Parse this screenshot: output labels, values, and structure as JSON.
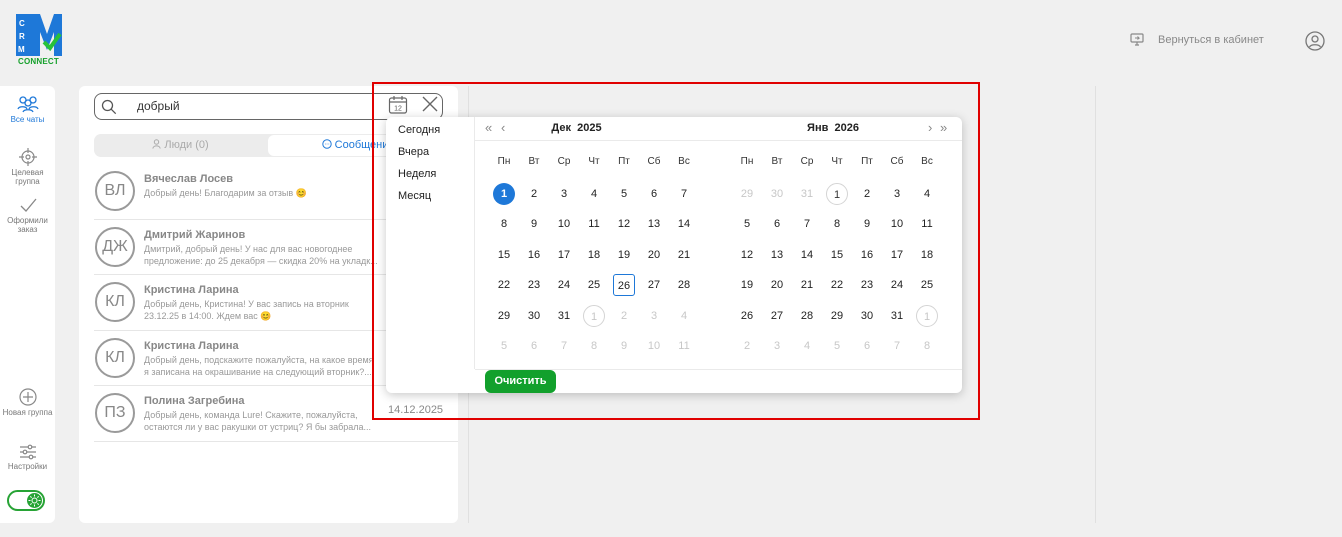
{
  "app": {
    "logo_text": "CONNECT",
    "brand_colors": {
      "blue": "#1e78d8",
      "green": "#15a02b"
    }
  },
  "topbar": {
    "back_label": "Вернуться в кабинет"
  },
  "nav": {
    "items": [
      {
        "label": "Все чаты",
        "icon": "users-icon",
        "active": true
      },
      {
        "label": "Целевая группа",
        "icon": "target-icon"
      },
      {
        "label": "Оформили заказ",
        "icon": "check-icon"
      },
      {
        "label": "Новая группа",
        "icon": "plus-circle-icon"
      },
      {
        "label": "Настройки",
        "icon": "sliders-icon"
      }
    ]
  },
  "search": {
    "value": "добрый"
  },
  "tabs": {
    "people": "Люди (0)",
    "messages": "Сообщения"
  },
  "chats": [
    {
      "initials": "ВЛ",
      "name": "Вячеслав Лосев",
      "preview": "Добрый день! Благодарим за отзыв 😊",
      "date": ""
    },
    {
      "initials": "ДЖ",
      "name": "Дмитрий Жаринов",
      "preview": "Дмитрий, добрый день! У нас для вас новогоднее предложение: до 25 декабря — скидка 20% на укладк...",
      "date": ""
    },
    {
      "initials": "КЛ",
      "name": "Кристина Ларина",
      "preview": "Добрый день, Кристина! У вас запись на вторник 23.12.25 в 14:00. Ждем вас 😊",
      "date": ""
    },
    {
      "initials": "КЛ",
      "name": "Кристина Ларина",
      "preview": "Добрый день, подскажите пожалуйста, на какое время я записана на окрашивание на следующий вторник?...",
      "date": ""
    },
    {
      "initials": "ПЗ",
      "name": "Полина Загребина",
      "preview": "Добрый день, команда Lure! Скажите, пожалуйста, остаются ли у вас ракушки от устриц? Я бы забрала...",
      "date": "14.12.2025"
    }
  ],
  "picker": {
    "presets": [
      "Сегодня",
      "Вчера",
      "Неделя",
      "Месяц"
    ],
    "weekdays": [
      "Пн",
      "Вт",
      "Ср",
      "Чт",
      "Пт",
      "Сб",
      "Вс"
    ],
    "months": [
      {
        "month": "Дек",
        "year": "2025",
        "weeks": [
          [
            [
              1,
              "",
              1
            ],
            [
              2,
              "",
              0
            ],
            [
              3,
              "",
              0
            ],
            [
              4,
              "",
              0
            ],
            [
              5,
              "",
              0
            ],
            [
              6,
              "",
              0
            ],
            [
              7,
              "",
              0
            ]
          ],
          [
            [
              8,
              "",
              0
            ],
            [
              9,
              "",
              0
            ],
            [
              10,
              "",
              0
            ],
            [
              11,
              "",
              0
            ],
            [
              12,
              "",
              0
            ],
            [
              13,
              "",
              0
            ],
            [
              14,
              "",
              0
            ]
          ],
          [
            [
              15,
              "",
              0
            ],
            [
              16,
              "",
              0
            ],
            [
              17,
              "",
              0
            ],
            [
              18,
              "",
              0
            ],
            [
              19,
              "",
              0
            ],
            [
              20,
              "",
              0
            ],
            [
              21,
              "",
              0
            ]
          ],
          [
            [
              22,
              "",
              0
            ],
            [
              23,
              "",
              0
            ],
            [
              24,
              "",
              0
            ],
            [
              25,
              "",
              0
            ],
            [
              26,
              "t",
              0
            ],
            [
              27,
              "",
              0
            ],
            [
              28,
              "",
              0
            ]
          ],
          [
            [
              29,
              "",
              0
            ],
            [
              30,
              "",
              0
            ],
            [
              31,
              "",
              0
            ],
            [
              1,
              "o",
              2
            ],
            [
              2,
              "o",
              0
            ],
            [
              3,
              "o",
              0
            ],
            [
              4,
              "o",
              0
            ]
          ],
          [
            [
              5,
              "o",
              0
            ],
            [
              6,
              "o",
              0
            ],
            [
              7,
              "o",
              0
            ],
            [
              8,
              "o",
              0
            ],
            [
              9,
              "o",
              0
            ],
            [
              10,
              "o",
              0
            ],
            [
              11,
              "o",
              0
            ]
          ]
        ]
      },
      {
        "month": "Янв",
        "year": "2026",
        "weeks": [
          [
            [
              29,
              "o",
              0
            ],
            [
              30,
              "o",
              0
            ],
            [
              31,
              "o",
              0
            ],
            [
              1,
              "",
              2
            ],
            [
              2,
              "",
              0
            ],
            [
              3,
              "",
              0
            ],
            [
              4,
              "",
              0
            ]
          ],
          [
            [
              5,
              "",
              0
            ],
            [
              6,
              "",
              0
            ],
            [
              7,
              "",
              0
            ],
            [
              8,
              "",
              0
            ],
            [
              9,
              "",
              0
            ],
            [
              10,
              "",
              0
            ],
            [
              11,
              "",
              0
            ]
          ],
          [
            [
              12,
              "",
              0
            ],
            [
              13,
              "",
              0
            ],
            [
              14,
              "",
              0
            ],
            [
              15,
              "",
              0
            ],
            [
              16,
              "",
              0
            ],
            [
              17,
              "",
              0
            ],
            [
              18,
              "",
              0
            ]
          ],
          [
            [
              19,
              "",
              0
            ],
            [
              20,
              "",
              0
            ],
            [
              21,
              "",
              0
            ],
            [
              22,
              "",
              0
            ],
            [
              23,
              "",
              0
            ],
            [
              24,
              "",
              0
            ],
            [
              25,
              "",
              0
            ]
          ],
          [
            [
              26,
              "",
              0
            ],
            [
              27,
              "",
              0
            ],
            [
              28,
              "",
              0
            ],
            [
              29,
              "",
              0
            ],
            [
              30,
              "",
              0
            ],
            [
              31,
              "",
              0
            ],
            [
              1,
              "o",
              2
            ]
          ],
          [
            [
              2,
              "o",
              0
            ],
            [
              3,
              "o",
              0
            ],
            [
              4,
              "o",
              0
            ],
            [
              5,
              "o",
              0
            ],
            [
              6,
              "o",
              0
            ],
            [
              7,
              "o",
              0
            ],
            [
              8,
              "o",
              0
            ]
          ]
        ]
      }
    ],
    "selected_date": "01.12.2025",
    "today_date": "26.12.2025",
    "clear_label": "Очистить"
  }
}
